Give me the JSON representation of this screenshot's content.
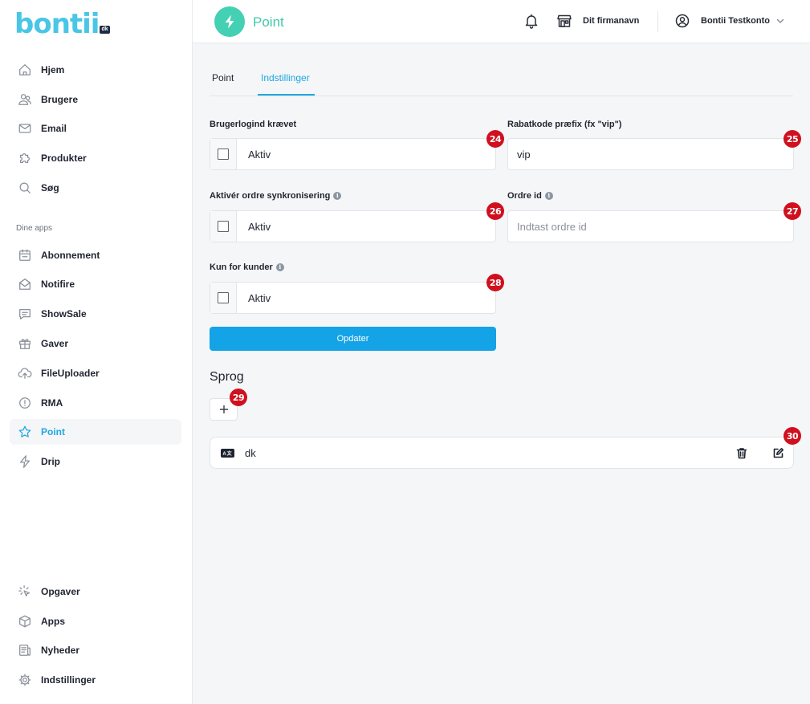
{
  "brand": {
    "logo_text": "bontii",
    "logo_badge": "dk"
  },
  "sidebar": {
    "items": [
      {
        "label": "Hjem",
        "icon": "home-icon"
      },
      {
        "label": "Brugere",
        "icon": "users-icon"
      },
      {
        "label": "Email",
        "icon": "mail-icon"
      },
      {
        "label": "Produkter",
        "icon": "puzzle-icon"
      },
      {
        "label": "Søg",
        "icon": "search-icon"
      }
    ],
    "apps_section_label": "Dine apps",
    "apps": [
      {
        "label": "Abonnement",
        "icon": "calendar-icon"
      },
      {
        "label": "Notifire",
        "icon": "envelope-open-icon"
      },
      {
        "label": "ShowSale",
        "icon": "chat-icon"
      },
      {
        "label": "Gaver",
        "icon": "gift-icon"
      },
      {
        "label": "FileUploader",
        "icon": "cloud-upload-icon"
      },
      {
        "label": "RMA",
        "icon": "alert-circle-icon"
      },
      {
        "label": "Point",
        "icon": "star-icon",
        "active": true
      },
      {
        "label": "Drip",
        "icon": "bolt-icon"
      }
    ],
    "bottom": [
      {
        "label": "Opgaver",
        "icon": "cursor-click-icon"
      },
      {
        "label": "Apps",
        "icon": "cube-icon"
      },
      {
        "label": "Nyheder",
        "icon": "newspaper-icon"
      },
      {
        "label": "Indstillinger",
        "icon": "gear-icon"
      }
    ]
  },
  "header": {
    "app_title": "Point",
    "app_icon": "bolt-icon",
    "company": "Dit firmanavn",
    "user": "Bontii Testkonto",
    "accent": "#43d0b3"
  },
  "tabs": [
    {
      "label": "Point"
    },
    {
      "label": "Indstillinger",
      "active": true
    }
  ],
  "form": {
    "login_required": {
      "label": "Brugerlogind krævet",
      "checkbox_text": "Aktiv",
      "checked": false,
      "badge": "24"
    },
    "discount_prefix": {
      "label": "Rabatkode præfix (fx \"vip\")",
      "value": "vip",
      "badge": "25"
    },
    "order_sync": {
      "label": "Aktivér ordre synkronisering",
      "checkbox_text": "Aktiv",
      "checked": false,
      "badge": "26"
    },
    "order_id": {
      "label": "Ordre id",
      "placeholder": "Indtast ordre id",
      "badge": "27"
    },
    "customers_only": {
      "label": "Kun for kunder",
      "checkbox_text": "Aktiv",
      "checked": false,
      "badge": "28"
    },
    "update_button": "Opdater"
  },
  "languages": {
    "title": "Sprog",
    "add_badge": "29",
    "rows": [
      {
        "code": "dk",
        "flag_text": "A文",
        "badge": "30"
      }
    ]
  },
  "colors": {
    "primary": "#14a3e6",
    "badge": "#d0101e",
    "logo": "#49c6e5"
  }
}
